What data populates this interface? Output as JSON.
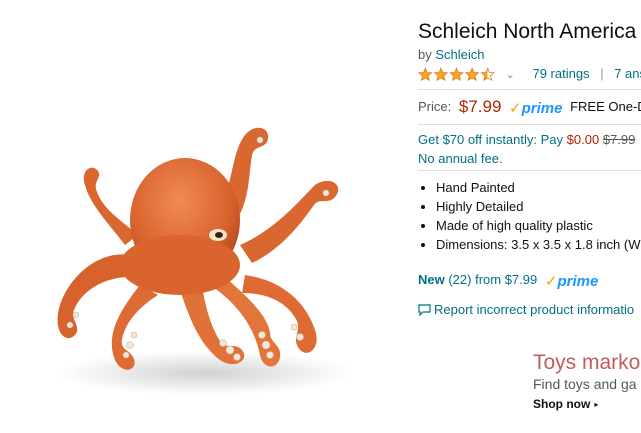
{
  "product": {
    "title": "Schleich North America",
    "by_label": "by",
    "brand": "Schleich",
    "ratings_count": "79 ratings",
    "answered": "7 ans",
    "rating_value": 4.5,
    "star_color": "#ffa41c",
    "price_label": "Price:",
    "price": "$7.99",
    "prime_check": "✓",
    "prime_word": "prime",
    "shipping": "FREE One-Day",
    "promo": {
      "line1_a": "Get $70 off instantly: Pay",
      "line1_price": "$0.00",
      "line1_strike": "$7.99",
      "line2": "No annual fee."
    },
    "features": [
      "Hand Painted",
      "Highly Detailed",
      "Made of high quality plastic",
      "Dimensions: 3.5 x 3.5 x 1.8 inch (W"
    ],
    "new_offers_label": "New",
    "new_offers_rest": " (22) from $7.99",
    "report_link": "Report incorrect product informatio"
  },
  "ad": {
    "title": "Toys marko",
    "subtitle": "Find toys and ga",
    "cta": "Shop now",
    "cta_caret": "▸"
  },
  "icons": {
    "rating_chevron": "chevron-down-icon",
    "report": "comment-icon",
    "image": "octopus-figure"
  },
  "colors": {
    "link": "#007185",
    "price": "#b12704",
    "prime_blue": "#1a98ff",
    "prime_orange": "#f7a200",
    "octopus": "#e0703a"
  }
}
